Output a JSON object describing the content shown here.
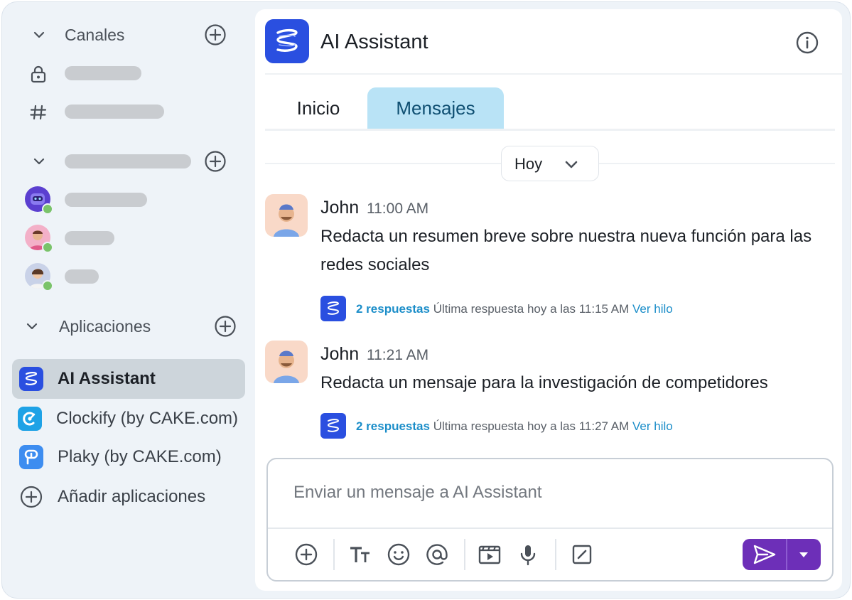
{
  "sidebar": {
    "channels_label": "Canales",
    "dm_label": "",
    "apps_label": "Aplicaciones",
    "apps": [
      {
        "label": "AI Assistant",
        "active": true
      },
      {
        "label": "Clockify (by CAKE.com)",
        "active": false
      },
      {
        "label": "Plaky (by CAKE.com)",
        "active": false
      },
      {
        "label": "Añadir aplicaciones",
        "active": false
      }
    ]
  },
  "header": {
    "title": "AI Assistant"
  },
  "tabs": [
    {
      "label": "Inicio",
      "active": false
    },
    {
      "label": "Mensajes",
      "active": true
    }
  ],
  "date_divider": {
    "label": "Hoy"
  },
  "messages": [
    {
      "author": "John",
      "time": "11:00 AM",
      "text": "Redacta un resumen breve sobre nuestra nueva función para las redes sociales",
      "thread": {
        "count": "2 respuestas",
        "last": "Última respuesta hoy a las 11:15 AM",
        "link": "Ver hilo"
      }
    },
    {
      "author": "John",
      "time": "11:21 AM",
      "text": "Redacta un mensaje para la investigación de competidores",
      "thread": {
        "count": "2 respuestas",
        "last": "Última respuesta hoy a las 11:27 AM",
        "link": "Ver hilo"
      }
    }
  ],
  "composer": {
    "placeholder": "Enviar un mensaje a AI Assistant",
    "value": ""
  },
  "colors": {
    "accent_tab": "#b9e3f6",
    "brand_blue": "#2a4fe0",
    "send_purple": "#6d2fb8",
    "link_blue": "#1c8ec9",
    "status_green": "#7ac36a"
  }
}
